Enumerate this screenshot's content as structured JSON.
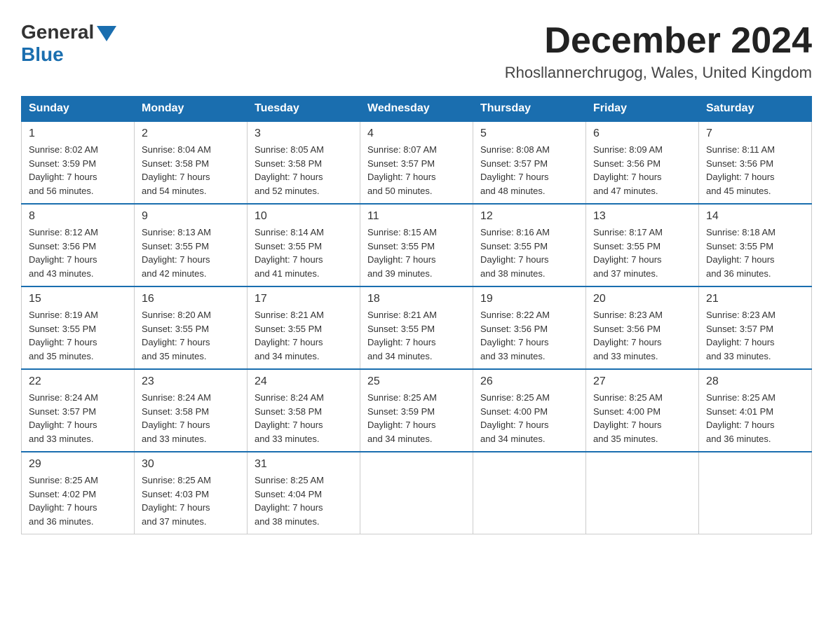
{
  "header": {
    "logo_general": "General",
    "logo_blue": "Blue",
    "month_title": "December 2024",
    "location": "Rhosllannerchrugog, Wales, United Kingdom"
  },
  "weekdays": [
    "Sunday",
    "Monday",
    "Tuesday",
    "Wednesday",
    "Thursday",
    "Friday",
    "Saturday"
  ],
  "weeks": [
    [
      {
        "day": "1",
        "sunrise": "8:02 AM",
        "sunset": "3:59 PM",
        "daylight": "7 hours and 56 minutes."
      },
      {
        "day": "2",
        "sunrise": "8:04 AM",
        "sunset": "3:58 PM",
        "daylight": "7 hours and 54 minutes."
      },
      {
        "day": "3",
        "sunrise": "8:05 AM",
        "sunset": "3:58 PM",
        "daylight": "7 hours and 52 minutes."
      },
      {
        "day": "4",
        "sunrise": "8:07 AM",
        "sunset": "3:57 PM",
        "daylight": "7 hours and 50 minutes."
      },
      {
        "day": "5",
        "sunrise": "8:08 AM",
        "sunset": "3:57 PM",
        "daylight": "7 hours and 48 minutes."
      },
      {
        "day": "6",
        "sunrise": "8:09 AM",
        "sunset": "3:56 PM",
        "daylight": "7 hours and 47 minutes."
      },
      {
        "day": "7",
        "sunrise": "8:11 AM",
        "sunset": "3:56 PM",
        "daylight": "7 hours and 45 minutes."
      }
    ],
    [
      {
        "day": "8",
        "sunrise": "8:12 AM",
        "sunset": "3:56 PM",
        "daylight": "7 hours and 43 minutes."
      },
      {
        "day": "9",
        "sunrise": "8:13 AM",
        "sunset": "3:55 PM",
        "daylight": "7 hours and 42 minutes."
      },
      {
        "day": "10",
        "sunrise": "8:14 AM",
        "sunset": "3:55 PM",
        "daylight": "7 hours and 41 minutes."
      },
      {
        "day": "11",
        "sunrise": "8:15 AM",
        "sunset": "3:55 PM",
        "daylight": "7 hours and 39 minutes."
      },
      {
        "day": "12",
        "sunrise": "8:16 AM",
        "sunset": "3:55 PM",
        "daylight": "7 hours and 38 minutes."
      },
      {
        "day": "13",
        "sunrise": "8:17 AM",
        "sunset": "3:55 PM",
        "daylight": "7 hours and 37 minutes."
      },
      {
        "day": "14",
        "sunrise": "8:18 AM",
        "sunset": "3:55 PM",
        "daylight": "7 hours and 36 minutes."
      }
    ],
    [
      {
        "day": "15",
        "sunrise": "8:19 AM",
        "sunset": "3:55 PM",
        "daylight": "7 hours and 35 minutes."
      },
      {
        "day": "16",
        "sunrise": "8:20 AM",
        "sunset": "3:55 PM",
        "daylight": "7 hours and 35 minutes."
      },
      {
        "day": "17",
        "sunrise": "8:21 AM",
        "sunset": "3:55 PM",
        "daylight": "7 hours and 34 minutes."
      },
      {
        "day": "18",
        "sunrise": "8:21 AM",
        "sunset": "3:55 PM",
        "daylight": "7 hours and 34 minutes."
      },
      {
        "day": "19",
        "sunrise": "8:22 AM",
        "sunset": "3:56 PM",
        "daylight": "7 hours and 33 minutes."
      },
      {
        "day": "20",
        "sunrise": "8:23 AM",
        "sunset": "3:56 PM",
        "daylight": "7 hours and 33 minutes."
      },
      {
        "day": "21",
        "sunrise": "8:23 AM",
        "sunset": "3:57 PM",
        "daylight": "7 hours and 33 minutes."
      }
    ],
    [
      {
        "day": "22",
        "sunrise": "8:24 AM",
        "sunset": "3:57 PM",
        "daylight": "7 hours and 33 minutes."
      },
      {
        "day": "23",
        "sunrise": "8:24 AM",
        "sunset": "3:58 PM",
        "daylight": "7 hours and 33 minutes."
      },
      {
        "day": "24",
        "sunrise": "8:24 AM",
        "sunset": "3:58 PM",
        "daylight": "7 hours and 33 minutes."
      },
      {
        "day": "25",
        "sunrise": "8:25 AM",
        "sunset": "3:59 PM",
        "daylight": "7 hours and 34 minutes."
      },
      {
        "day": "26",
        "sunrise": "8:25 AM",
        "sunset": "4:00 PM",
        "daylight": "7 hours and 34 minutes."
      },
      {
        "day": "27",
        "sunrise": "8:25 AM",
        "sunset": "4:00 PM",
        "daylight": "7 hours and 35 minutes."
      },
      {
        "day": "28",
        "sunrise": "8:25 AM",
        "sunset": "4:01 PM",
        "daylight": "7 hours and 36 minutes."
      }
    ],
    [
      {
        "day": "29",
        "sunrise": "8:25 AM",
        "sunset": "4:02 PM",
        "daylight": "7 hours and 36 minutes."
      },
      {
        "day": "30",
        "sunrise": "8:25 AM",
        "sunset": "4:03 PM",
        "daylight": "7 hours and 37 minutes."
      },
      {
        "day": "31",
        "sunrise": "8:25 AM",
        "sunset": "4:04 PM",
        "daylight": "7 hours and 38 minutes."
      },
      null,
      null,
      null,
      null
    ]
  ],
  "labels": {
    "sunrise": "Sunrise:",
    "sunset": "Sunset:",
    "daylight": "Daylight:"
  }
}
